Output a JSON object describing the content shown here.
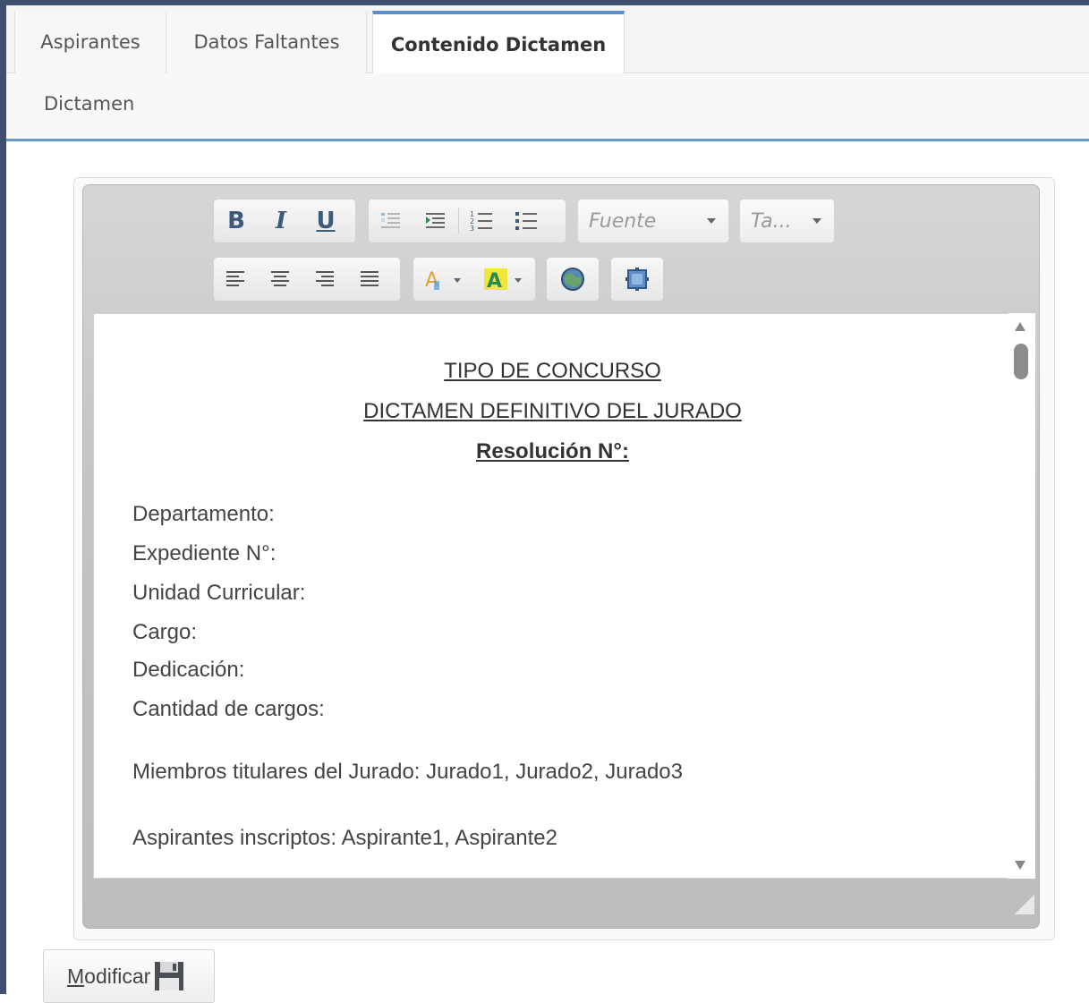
{
  "tabs": [
    {
      "label": "Aspirantes",
      "active": false
    },
    {
      "label": "Datos Faltantes",
      "active": false
    },
    {
      "label": "Contenido Dictamen",
      "active": true
    }
  ],
  "subtab": {
    "label": "Dictamen"
  },
  "toolbar": {
    "bold": "B",
    "italic": "I",
    "underline": "U",
    "font_placeholder": "Fuente",
    "size_placeholder": "Ta..."
  },
  "document": {
    "heading1": "TIPO DE CONCURSO",
    "heading2": "DICTAMEN DEFINITIVO DEL JURADO",
    "heading3": "Resolución N°:",
    "fields": [
      "Departamento:",
      "Expediente N°:",
      "Unidad Curricular:",
      "Cargo:",
      "Dedicación:",
      "Cantidad de cargos:"
    ],
    "jurado": "Miembros titulares del Jurado: Jurado1, Jurado2, Jurado3",
    "aspirantes": "Aspirantes inscriptos: Aspirante1, Aspirante2"
  },
  "actions": {
    "modify_first": "M",
    "modify_rest": "odificar"
  },
  "colors": {
    "accent": "#5b8fc9",
    "frame": "#3f4f70",
    "icon_blue": "#3c5b7b"
  }
}
